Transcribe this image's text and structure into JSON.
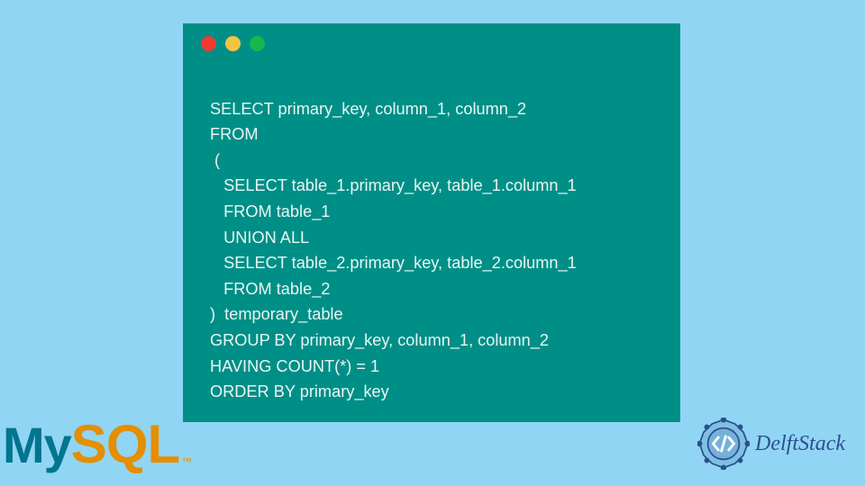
{
  "code": {
    "lines": [
      "SELECT primary_key, column_1, column_2",
      "FROM",
      " (",
      "   SELECT table_1.primary_key, table_1.column_1",
      "   FROM table_1",
      "   UNION ALL",
      "   SELECT table_2.primary_key, table_2.column_1",
      "   FROM table_2",
      ")  temporary_table",
      "GROUP BY primary_key, column_1, column_2",
      "HAVING COUNT(*) = 1",
      "ORDER BY primary_key"
    ]
  },
  "mysql": {
    "part1": "My",
    "part2": "SQL",
    "tm": "™"
  },
  "delftstack": {
    "label": "DelftStack"
  },
  "traffic": {
    "red": "close-icon",
    "yellow": "minimize-icon",
    "green": "maximize-icon"
  }
}
